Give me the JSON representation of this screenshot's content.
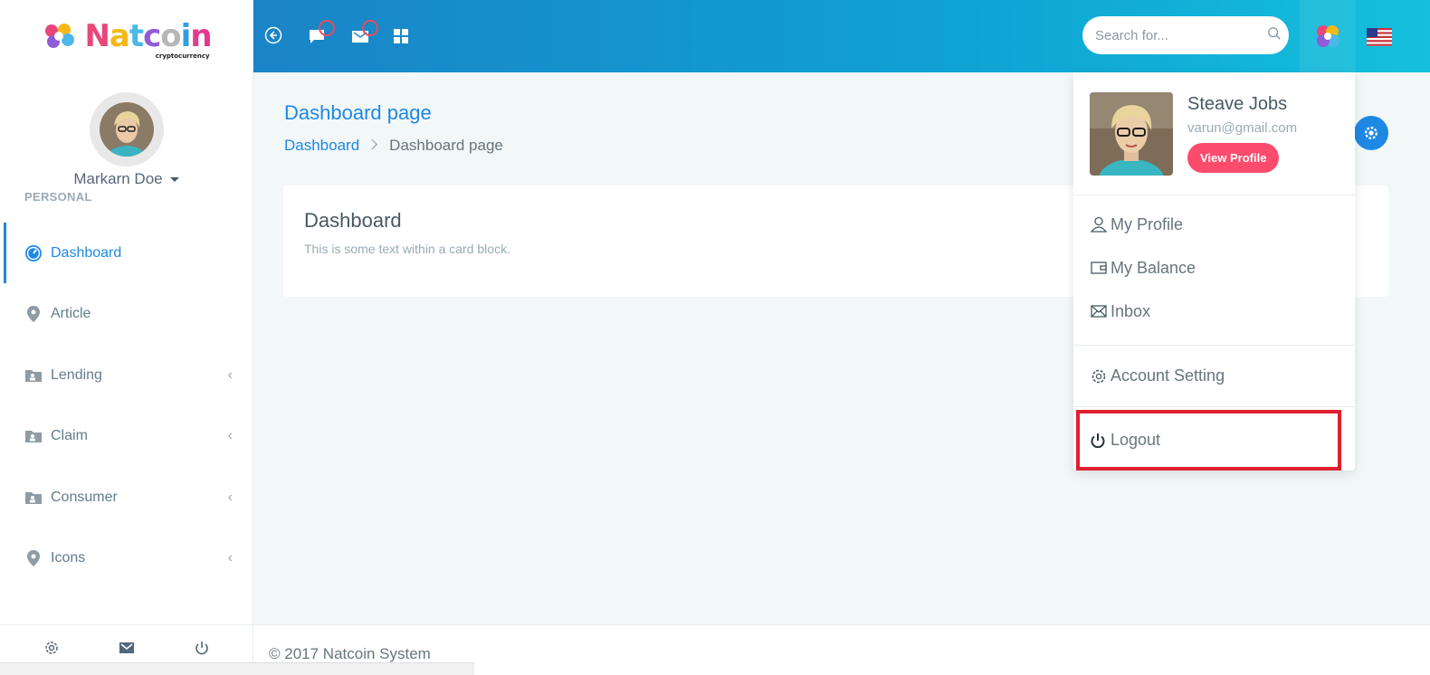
{
  "brand": {
    "name": "Natcoin",
    "tagline": "cryptocurrency"
  },
  "sidebar": {
    "user_name": "Markarn Doe",
    "section_label": "PERSONAL",
    "items": [
      {
        "label": "Dashboard",
        "icon": "gauge-icon",
        "active": true
      },
      {
        "label": "Article",
        "icon": "map-pin-icon",
        "has_arrow": false
      },
      {
        "label": "Lending",
        "icon": "folder-user-icon",
        "has_arrow": true
      },
      {
        "label": "Claim",
        "icon": "folder-user-icon",
        "has_arrow": true
      },
      {
        "label": "Consumer",
        "icon": "folder-user-icon",
        "has_arrow": true
      },
      {
        "label": "Icons",
        "icon": "map-pin-icon",
        "has_arrow": true
      }
    ],
    "footer_icons": [
      "gear-icon",
      "mail-icon",
      "power-icon"
    ]
  },
  "topbar": {
    "search_placeholder": "Search for...",
    "icons": [
      "back-arrow-icon",
      "message-icon",
      "mail-icon",
      "apps-grid-icon",
      "user-logo-icon",
      "us-flag-icon"
    ],
    "gradient_start": "#1a84c6",
    "gradient_end": "#14c0dc"
  },
  "page": {
    "title": "Dashboard page",
    "breadcrumb_root": "Dashboard",
    "breadcrumb_current": "Dashboard page"
  },
  "card": {
    "title": "Dashboard",
    "text": "This is some text within a card block."
  },
  "footer": {
    "text": "© 2017 Natcoin System"
  },
  "dropdown": {
    "name": "Steave Jobs",
    "email": "varun@gmail.com",
    "view_profile": "View Profile",
    "items": [
      "My Profile",
      "My Balance",
      "Inbox"
    ],
    "setting": "Account Setting",
    "logout": "Logout",
    "highlight_color": "#e0202e"
  },
  "colors": {
    "accent": "#1e88e5",
    "danger": "#fc4b6c"
  }
}
